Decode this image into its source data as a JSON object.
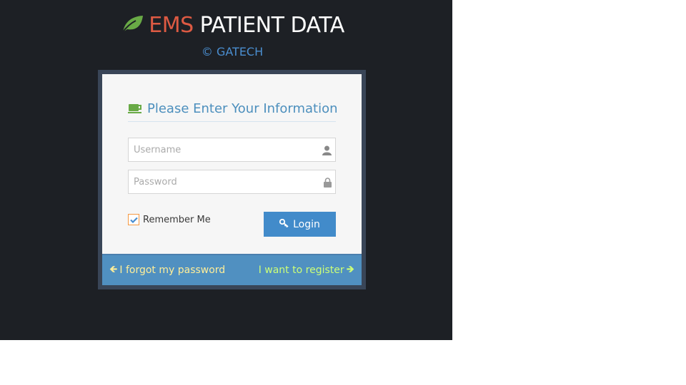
{
  "header": {
    "title_accent": "EMS",
    "title_rest": "PATIENT DATA",
    "subtitle": "© GATECH"
  },
  "form": {
    "heading": "Please Enter Your Information",
    "username_placeholder": "Username",
    "password_placeholder": "Password",
    "remember_label": "Remember Me",
    "remember_checked": true,
    "login_label": "Login"
  },
  "footer": {
    "forgot_label": "I forgot my password",
    "register_label": "I want to register"
  },
  "colors": {
    "accent_red": "#dd5a43",
    "link_blue": "#4a8ed0",
    "button": "#428bca",
    "forgot": "#ffee99",
    "register": "#ccff77"
  }
}
